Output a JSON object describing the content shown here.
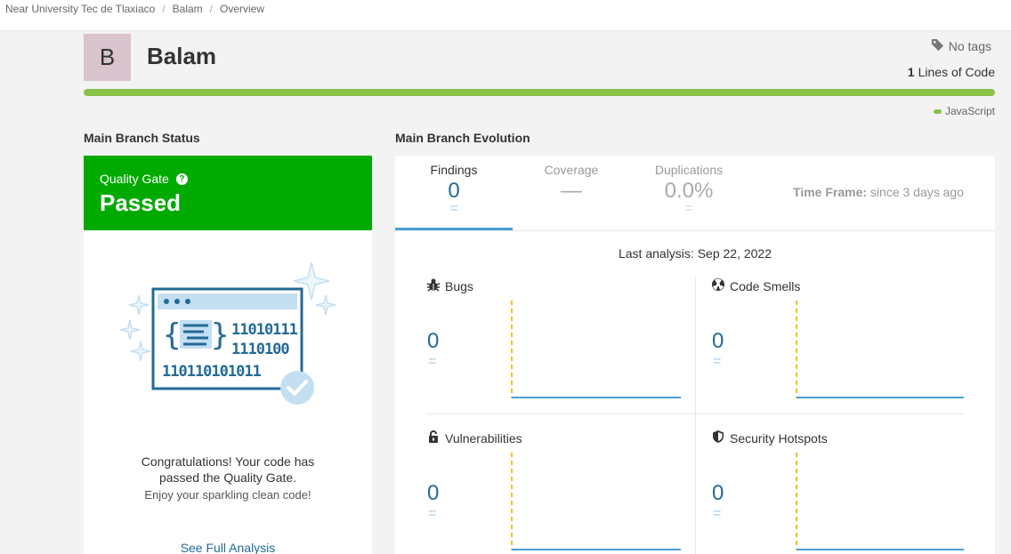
{
  "breadcrumb": [
    "Near University Tec de Tlaxiaco",
    "Balam",
    "Overview"
  ],
  "project": {
    "avatar_letter": "B",
    "name": "Balam",
    "tags": "No tags",
    "lines_of_code_value": "1",
    "lines_of_code_label": "Lines of Code",
    "language": "JavaScript",
    "language_color": "#8bc34a"
  },
  "quality_gate": {
    "section_title": "Main Branch Status",
    "label": "Quality Gate",
    "help": "?",
    "status": "Passed",
    "status_color": "#00aa00",
    "congrats_line1": "Congratulations! Your code has",
    "congrats_line2": "passed the Quality Gate.",
    "enjoy": "Enjoy your sparkling clean code!",
    "full_analysis": "See Full Analysis"
  },
  "evolution": {
    "section_title": "Main Branch Evolution",
    "tabs": [
      {
        "label": "Findings",
        "value": "0",
        "eq": "="
      },
      {
        "label": "Coverage",
        "value": "—",
        "eq": ""
      },
      {
        "label": "Duplications",
        "value": "0.0%",
        "eq": "="
      }
    ],
    "timeframe_label": "Time Frame:",
    "timeframe_value": "since 3 days ago",
    "last_analysis": "Last analysis: Sep 22, 2022",
    "metrics": [
      {
        "label": "Bugs",
        "icon": "bug-icon",
        "value": "0",
        "eq": "="
      },
      {
        "label": "Code Smells",
        "icon": "code-smell-icon",
        "value": "0",
        "eq": "="
      },
      {
        "label": "Vulnerabilities",
        "icon": "lock-icon",
        "value": "0",
        "eq": "="
      },
      {
        "label": "Security Hotspots",
        "icon": "shield-icon",
        "value": "0",
        "eq": "="
      }
    ]
  },
  "colors": {
    "accent": "#236a97",
    "chart_line": "#4b9fd5",
    "marker": "#f4c20d"
  }
}
